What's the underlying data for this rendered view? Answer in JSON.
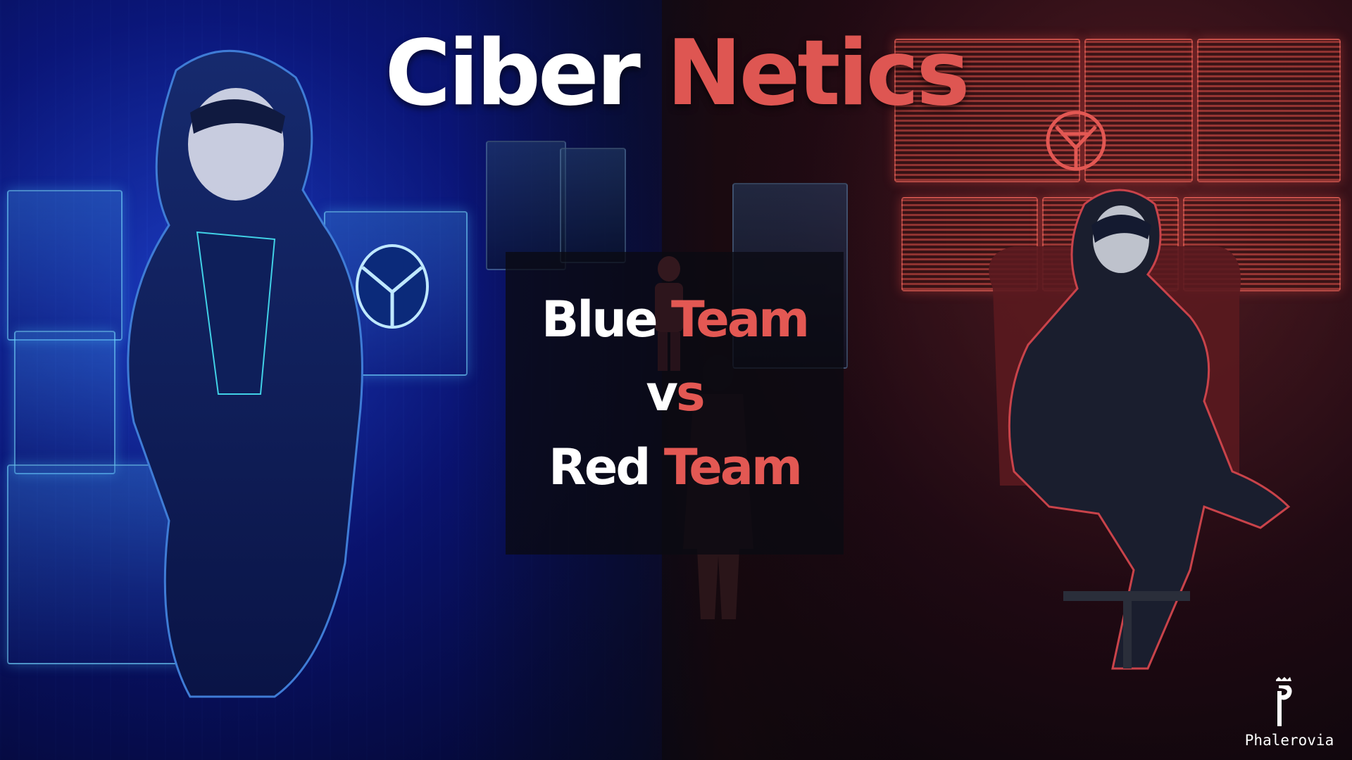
{
  "title": {
    "part1": "Ciber",
    "part2": "Netics"
  },
  "versus": {
    "blue_word": "Blue",
    "team_word_1": "Team",
    "vs_v": "v",
    "vs_s": "s",
    "red_word": "Red",
    "team_word_2": "Team"
  },
  "watermark": {
    "text": "Phalerovia"
  },
  "colors": {
    "accent_red": "#de5652",
    "white": "#ffffff",
    "blue_bg": "#0b1a7a",
    "dark_bg": "#0e0a12"
  }
}
